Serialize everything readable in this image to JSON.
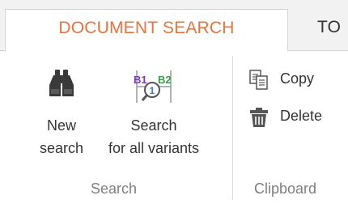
{
  "tabs": {
    "active": "DOCUMENT SEARCH",
    "next": "TO"
  },
  "search_group": {
    "label": "Search",
    "new_search": {
      "line1": "New",
      "line2": "search",
      "icon": "binoculars-icon"
    },
    "search_all_variants": {
      "line1": "Search",
      "line2": "for all variants",
      "icon": "variants-search-icon",
      "badge_left": "B1",
      "badge_right": "B2",
      "badge_center": "1"
    }
  },
  "clipboard_group": {
    "label": "Clipboard",
    "copy": {
      "label": "Copy",
      "icon": "copy-icon"
    },
    "delete": {
      "label": "Delete",
      "icon": "trash-icon"
    }
  },
  "colors": {
    "accent": "#e8743b",
    "badge_blue": "#3b7bc8",
    "badge_green": "#3a9a4e",
    "badge_purple": "#7a3aa8"
  }
}
